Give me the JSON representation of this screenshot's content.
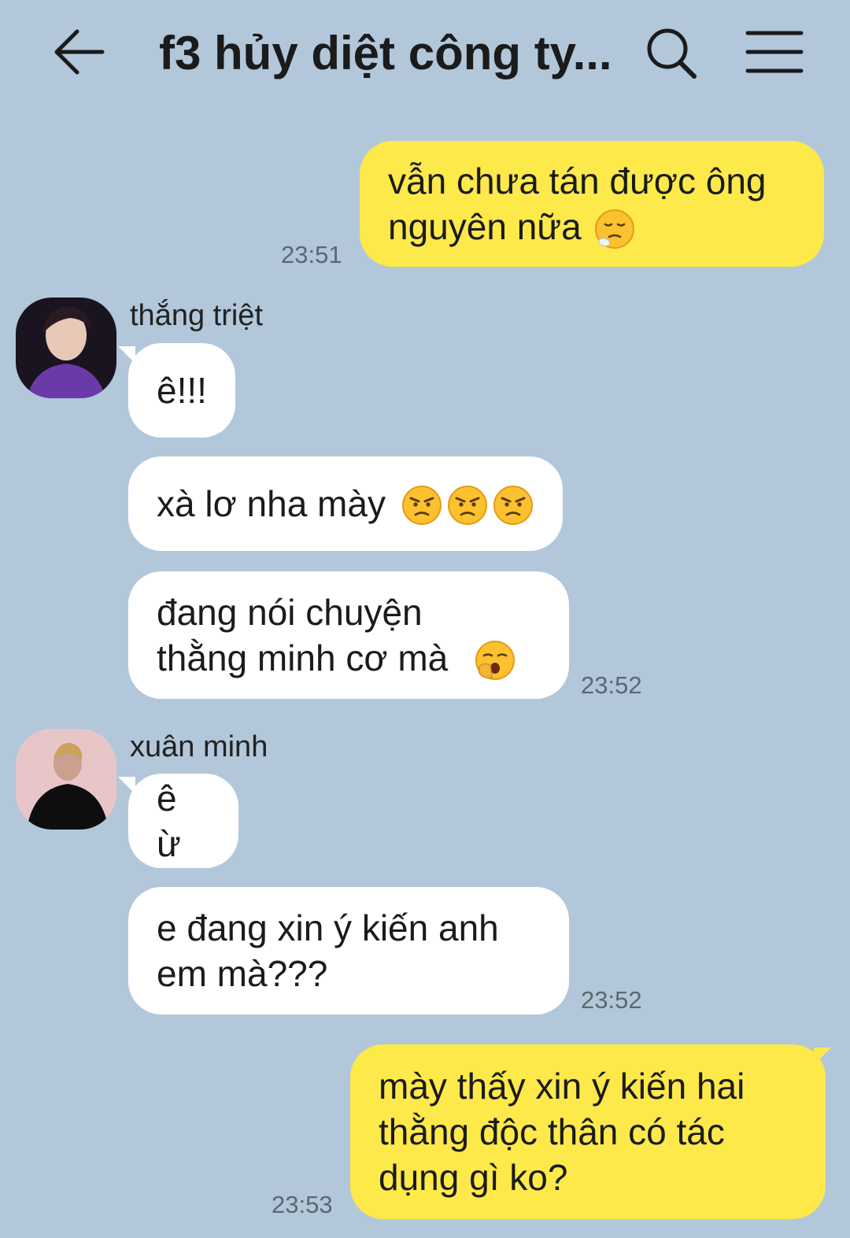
{
  "header": {
    "title": "f3 hủy diệt công ty...",
    "back_icon": "arrow-left-icon",
    "search_icon": "search-icon",
    "menu_icon": "hamburger-menu-icon"
  },
  "colors": {
    "background": "#b2c7da",
    "outgoing_bubble": "#fee94a",
    "incoming_bubble": "#ffffff"
  },
  "messages": [
    {
      "direction": "out",
      "text": "vẫn chưa tán được ông\nnguyên nữa",
      "emoji": [
        "face-exhaling"
      ],
      "time": "23:51"
    },
    {
      "direction": "in",
      "sender": "thắng triệt",
      "text": "ê!!!",
      "emoji": []
    },
    {
      "direction": "in",
      "text": "xà lơ nha mày",
      "emoji": [
        "angry-face",
        "angry-face",
        "angry-face"
      ]
    },
    {
      "direction": "in",
      "text": "đang nói chuyện\nthằng minh cơ mà",
      "emoji": [
        "yawning-face"
      ],
      "time": "23:52"
    },
    {
      "direction": "in",
      "sender": "xuân minh",
      "text": "ê ừ",
      "emoji": []
    },
    {
      "direction": "in",
      "text": "e đang xin ý kiến anh\nem mà???",
      "emoji": [],
      "time": "23:52"
    },
    {
      "direction": "out",
      "text": "mày thấy xin ý kiến hai\nthằng độc thân có tác\ndụng gì ko?",
      "emoji": [],
      "time": "23:53"
    }
  ]
}
